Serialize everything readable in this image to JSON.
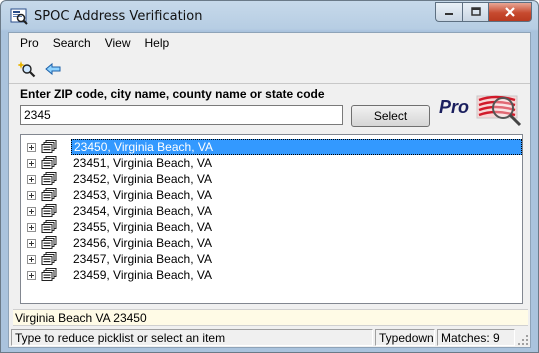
{
  "window": {
    "title": "SPOC Address Verification",
    "icon": "spoc-app-icon"
  },
  "menu": {
    "items": [
      "Pro",
      "Search",
      "View",
      "Help"
    ]
  },
  "toolbar": {
    "buttons": [
      {
        "icon": "magnifier-sparkle-icon"
      },
      {
        "icon": "back-arrow-icon"
      }
    ]
  },
  "search": {
    "label": "Enter ZIP code, city name, county name or state code",
    "value": "2345",
    "select_label": "Select"
  },
  "logo": {
    "text": "Pro"
  },
  "results": {
    "selected_index": 0,
    "items": [
      "23450, Virginia Beach, VA",
      "23451, Virginia Beach, VA",
      "23452, Virginia Beach, VA",
      "23453, Virginia Beach, VA",
      "23454, Virginia Beach, VA",
      "23455, Virginia Beach, VA",
      "23456, Virginia Beach, VA",
      "23457, Virginia Beach, VA",
      "23459, Virginia Beach, VA"
    ]
  },
  "address_line": "Virginia Beach VA 23450",
  "status": {
    "hint": "Type to reduce picklist or select an item",
    "mode": "Typedown",
    "matches": "Matches: 9"
  },
  "colors": {
    "selection": "#3399ff",
    "title_gradient_top": "#c7d9ea",
    "close_button": "#c74a2f"
  }
}
